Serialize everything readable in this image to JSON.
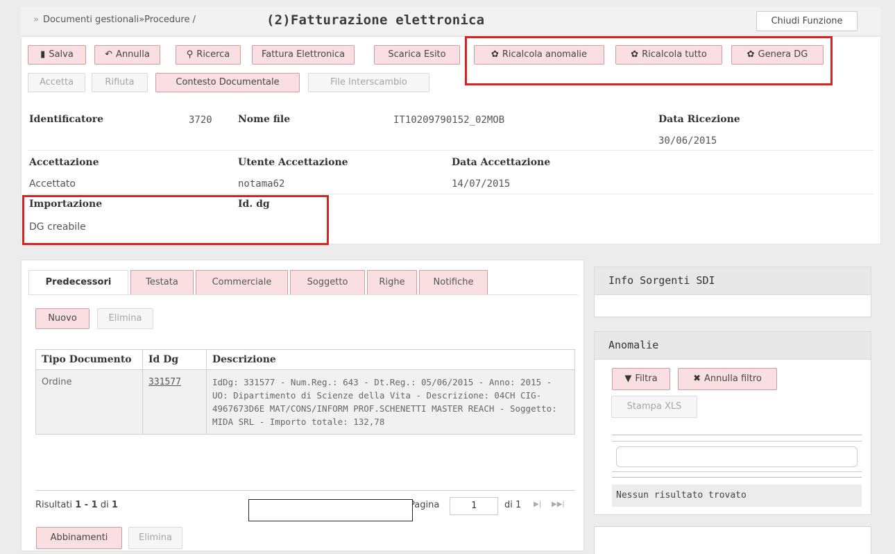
{
  "header": {
    "breadcrumb_prefix": "»",
    "breadcrumb": "Documenti gestionali»Procedure /",
    "title": "(2)Fatturazione elettronica",
    "close_label": "Chiudi Funzione"
  },
  "toolbar": {
    "row1": [
      {
        "label": "Salva",
        "icon": "save-icon",
        "glyph": "▮"
      },
      {
        "label": "Annulla",
        "icon": "undo-icon",
        "glyph": "↶"
      },
      {
        "label": "Ricerca",
        "icon": "search-icon",
        "glyph": "⚲"
      },
      {
        "label": "Fattura Elettronica"
      },
      {
        "label": "Scarica Esito"
      },
      {
        "label": "Ricalcola anomalie",
        "icon": "gear-icon",
        "glyph": "✿"
      },
      {
        "label": "Ricalcola tutto",
        "icon": "gear-icon",
        "glyph": "✿"
      },
      {
        "label": "Genera DG",
        "icon": "gear-icon",
        "glyph": "✿"
      }
    ],
    "row2": [
      {
        "label": "Accetta",
        "state": "disabled"
      },
      {
        "label": "Rifiuta",
        "state": "disabled"
      },
      {
        "label": "Contesto Documentale",
        "state": "enabled"
      },
      {
        "label": "File Interscambio",
        "state": "disabled"
      }
    ]
  },
  "details": {
    "identificatore_label": "Identificatore",
    "identificatore_value": "3720",
    "nome_file_label": "Nome file",
    "nome_file_value": "IT10209790152_02MOB",
    "data_ricezione_label": "Data Ricezione",
    "data_ricezione_value": "30/06/2015",
    "accettazione_label": "Accettazione",
    "accettazione_value": "Accettato",
    "utente_label": "Utente Accettazione",
    "utente_value": "notama62",
    "data_accettazione_label": "Data Accettazione",
    "data_accettazione_value": "14/07/2015",
    "importazione_label": "Importazione",
    "importazione_value": "DG creabile",
    "id_dg_label": "Id. dg",
    "id_dg_value": ""
  },
  "tabs": [
    {
      "label": "Predecessori",
      "active": true
    },
    {
      "label": "Testata"
    },
    {
      "label": "Commerciale"
    },
    {
      "label": "Soggetto"
    },
    {
      "label": "Righe"
    },
    {
      "label": "Notifiche"
    }
  ],
  "predecessori": {
    "nuovo_label": "Nuovo",
    "elimina_label": "Elimina",
    "columns": [
      "Tipo Documento",
      "Id Dg",
      "Descrizione"
    ],
    "rows": [
      {
        "tipo": "Ordine",
        "id": "331577",
        "descrizione": "IdDg: 331577 - Num.Reg.: 643 - Dt.Reg.: 05/06/2015 - Anno: 2015 - UO: Dipartimento di Scienze della Vita - Descrizione: 04CH CIG-4967673D6E MAT/CONS/INFORM PROF.SCHENETTI MASTER REACH - Soggetto: MIDA SRL - Importo totale: 132,78"
      }
    ],
    "results_prefix": "Risultati",
    "results_range": "1 - 1",
    "results_di": "di",
    "results_total": "1",
    "page_label": "Pagina",
    "page_value": "1",
    "page_of": "di 1",
    "abbinamenti_label": "Abbinamenti",
    "elimina2_label": "Elimina"
  },
  "info_sorgenti": {
    "title": "Info Sorgenti SDI"
  },
  "anomalie": {
    "title": "Anomalie",
    "filtra_label": "Filtra",
    "annulla_filtro_label": "Annulla filtro",
    "stampa_label": "Stampa XLS",
    "empty_message": "Nessun risultato trovato"
  },
  "colors": {
    "accent_pink": "#f9dfe1",
    "highlight_red": "#d62424"
  }
}
